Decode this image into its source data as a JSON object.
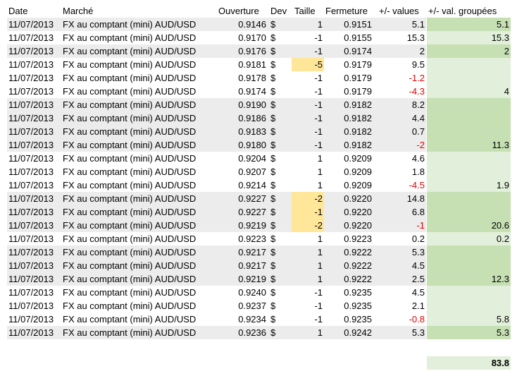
{
  "headers": {
    "date": "Date",
    "market": "Marché",
    "open": "Ouverture",
    "dev": "Dev",
    "size": "Taille",
    "close": "Fermeture",
    "values": "+/- values",
    "grouped": "+/- val. groupées"
  },
  "colors": {
    "row_shade": "#ececec",
    "size_highlight": "#ffe699",
    "group_light": "#e2efda",
    "group_dark": "#c6e0b4",
    "negative": "#e60000"
  },
  "rows": [
    {
      "date": "11/07/2013",
      "market": "FX au comptant  (mini) AUD/USD",
      "open": "0.9146",
      "dev": "$",
      "size": "1",
      "close": "0.9151",
      "val": "5.1",
      "grp": "5.1",
      "shade": true,
      "sizeHl": false,
      "neg": false,
      "grpStyle": "dark"
    },
    {
      "date": "11/07/2013",
      "market": "FX au comptant  (mini) AUD/USD",
      "open": "0.9170",
      "dev": "$",
      "size": "-1",
      "close": "0.9155",
      "val": "15.3",
      "grp": "15.3",
      "shade": false,
      "sizeHl": false,
      "neg": false,
      "grpStyle": "light"
    },
    {
      "date": "11/07/2013",
      "market": "FX au comptant  (mini) AUD/USD",
      "open": "0.9176",
      "dev": "$",
      "size": "-1",
      "close": "0.9174",
      "val": "2",
      "grp": "2",
      "shade": true,
      "sizeHl": false,
      "neg": false,
      "grpStyle": "dark"
    },
    {
      "date": "11/07/2013",
      "market": "FX au comptant  (mini) AUD/USD",
      "open": "0.9181",
      "dev": "$",
      "size": "-5",
      "close": "0.9179",
      "val": "9.5",
      "grp": "",
      "shade": false,
      "sizeHl": true,
      "neg": false,
      "grpStyle": "light"
    },
    {
      "date": "11/07/2013",
      "market": "FX au comptant  (mini) AUD/USD",
      "open": "0.9178",
      "dev": "$",
      "size": "-1",
      "close": "0.9179",
      "val": "-1.2",
      "grp": "",
      "shade": false,
      "sizeHl": false,
      "neg": true,
      "grpStyle": "light"
    },
    {
      "date": "11/07/2013",
      "market": "FX au comptant  (mini) AUD/USD",
      "open": "0.9174",
      "dev": "$",
      "size": "-1",
      "close": "0.9179",
      "val": "-4.3",
      "grp": "4",
      "shade": false,
      "sizeHl": false,
      "neg": true,
      "grpStyle": "light"
    },
    {
      "date": "11/07/2013",
      "market": "FX au comptant  (mini) AUD/USD",
      "open": "0.9190",
      "dev": "$",
      "size": "-1",
      "close": "0.9182",
      "val": "8.2",
      "grp": "",
      "shade": true,
      "sizeHl": false,
      "neg": false,
      "grpStyle": "dark"
    },
    {
      "date": "11/07/2013",
      "market": "FX au comptant  (mini) AUD/USD",
      "open": "0.9186",
      "dev": "$",
      "size": "-1",
      "close": "0.9182",
      "val": "4.4",
      "grp": "",
      "shade": true,
      "sizeHl": false,
      "neg": false,
      "grpStyle": "dark"
    },
    {
      "date": "11/07/2013",
      "market": "FX au comptant  (mini) AUD/USD",
      "open": "0.9183",
      "dev": "$",
      "size": "-1",
      "close": "0.9182",
      "val": "0.7",
      "grp": "",
      "shade": true,
      "sizeHl": false,
      "neg": false,
      "grpStyle": "dark"
    },
    {
      "date": "11/07/2013",
      "market": "FX au comptant  (mini) AUD/USD",
      "open": "0.9180",
      "dev": "$",
      "size": "-1",
      "close": "0.9182",
      "val": "-2",
      "grp": "11.3",
      "shade": true,
      "sizeHl": false,
      "neg": true,
      "grpStyle": "dark"
    },
    {
      "date": "11/07/2013",
      "market": "FX au comptant  (mini) AUD/USD",
      "open": "0.9204",
      "dev": "$",
      "size": "1",
      "close": "0.9209",
      "val": "4.6",
      "grp": "",
      "shade": false,
      "sizeHl": false,
      "neg": false,
      "grpStyle": "light"
    },
    {
      "date": "11/07/2013",
      "market": "FX au comptant  (mini) AUD/USD",
      "open": "0.9207",
      "dev": "$",
      "size": "1",
      "close": "0.9209",
      "val": "1.8",
      "grp": "",
      "shade": false,
      "sizeHl": false,
      "neg": false,
      "grpStyle": "light"
    },
    {
      "date": "11/07/2013",
      "market": "FX au comptant  (mini) AUD/USD",
      "open": "0.9214",
      "dev": "$",
      "size": "1",
      "close": "0.9209",
      "val": "-4.5",
      "grp": "1.9",
      "shade": false,
      "sizeHl": false,
      "neg": true,
      "grpStyle": "light"
    },
    {
      "date": "11/07/2013",
      "market": "FX au comptant  (mini) AUD/USD",
      "open": "0.9227",
      "dev": "$",
      "size": "-2",
      "close": "0.9220",
      "val": "14.8",
      "grp": "",
      "shade": true,
      "sizeHl": true,
      "neg": false,
      "grpStyle": "dark"
    },
    {
      "date": "11/07/2013",
      "market": "FX au comptant  (mini) AUD/USD",
      "open": "0.9227",
      "dev": "$",
      "size": "-1",
      "close": "0.9220",
      "val": "6.8",
      "grp": "",
      "shade": true,
      "sizeHl": true,
      "neg": false,
      "grpStyle": "dark"
    },
    {
      "date": "11/07/2013",
      "market": "FX au comptant  (mini) AUD/USD",
      "open": "0.9219",
      "dev": "$",
      "size": "-2",
      "close": "0.9220",
      "val": "-1",
      "grp": "20.6",
      "shade": true,
      "sizeHl": true,
      "neg": true,
      "grpStyle": "dark"
    },
    {
      "date": "11/07/2013",
      "market": "FX au comptant  (mini) AUD/USD",
      "open": "0.9223",
      "dev": "$",
      "size": "1",
      "close": "0.9223",
      "val": "0.2",
      "grp": "0.2",
      "shade": false,
      "sizeHl": false,
      "neg": false,
      "grpStyle": "light"
    },
    {
      "date": "11/07/2013",
      "market": "FX au comptant  (mini) AUD/USD",
      "open": "0.9217",
      "dev": "$",
      "size": "1",
      "close": "0.9222",
      "val": "5.3",
      "grp": "",
      "shade": true,
      "sizeHl": false,
      "neg": false,
      "grpStyle": "dark"
    },
    {
      "date": "11/07/2013",
      "market": "FX au comptant  (mini) AUD/USD",
      "open": "0.9217",
      "dev": "$",
      "size": "1",
      "close": "0.9222",
      "val": "4.5",
      "grp": "",
      "shade": true,
      "sizeHl": false,
      "neg": false,
      "grpStyle": "dark"
    },
    {
      "date": "11/07/2013",
      "market": "FX au comptant  (mini) AUD/USD",
      "open": "0.9219",
      "dev": "$",
      "size": "1",
      "close": "0.9222",
      "val": "2.5",
      "grp": "12.3",
      "shade": true,
      "sizeHl": false,
      "neg": false,
      "grpStyle": "dark"
    },
    {
      "date": "11/07/2013",
      "market": "FX au comptant  (mini) AUD/USD",
      "open": "0.9240",
      "dev": "$",
      "size": "-1",
      "close": "0.9235",
      "val": "4.5",
      "grp": "",
      "shade": false,
      "sizeHl": false,
      "neg": false,
      "grpStyle": "light"
    },
    {
      "date": "11/07/2013",
      "market": "FX au comptant  (mini) AUD/USD",
      "open": "0.9237",
      "dev": "$",
      "size": "-1",
      "close": "0.9235",
      "val": "2.1",
      "grp": "",
      "shade": false,
      "sizeHl": false,
      "neg": false,
      "grpStyle": "light"
    },
    {
      "date": "11/07/2013",
      "market": "FX au comptant  (mini) AUD/USD",
      "open": "0.9234",
      "dev": "$",
      "size": "-1",
      "close": "0.9235",
      "val": "-0.8",
      "grp": "5.8",
      "shade": false,
      "sizeHl": false,
      "neg": true,
      "grpStyle": "light"
    },
    {
      "date": "11/07/2013",
      "market": "FX au comptant  (mini) AUD/USD",
      "open": "0.9236",
      "dev": "$",
      "size": "1",
      "close": "0.9242",
      "val": "5.3",
      "grp": "5.3",
      "shade": true,
      "sizeHl": false,
      "neg": false,
      "grpStyle": "dark"
    }
  ],
  "total": "83.8"
}
